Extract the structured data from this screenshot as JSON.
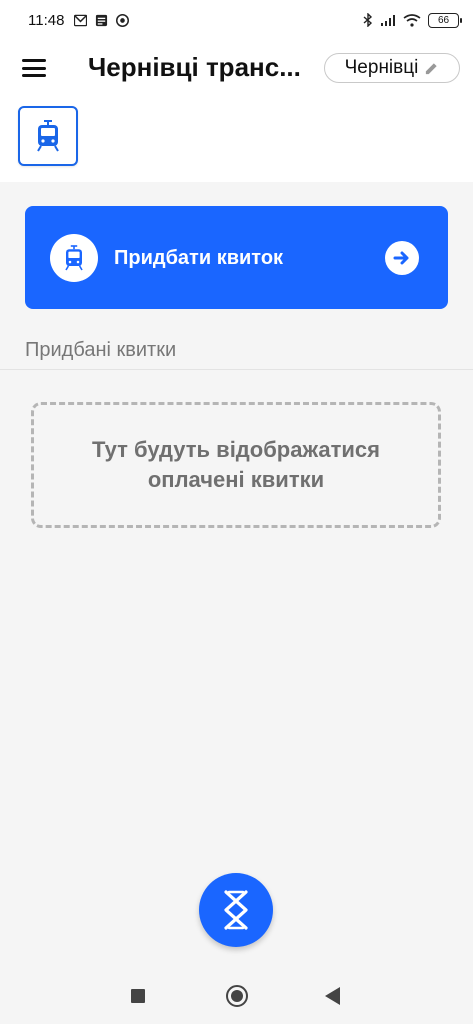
{
  "status_bar": {
    "time": "11:48",
    "battery": "66",
    "icons": [
      "gmail-icon",
      "news-icon",
      "chrome-icon",
      "bluetooth-icon",
      "signal-icon",
      "wifi-icon",
      "battery-icon"
    ]
  },
  "app_bar": {
    "title": "Чернівці транс...",
    "city": "Чернівці",
    "icons": [
      "menu-icon",
      "edit-pencil-icon"
    ]
  },
  "transport": {
    "selected_icon": "tram-icon",
    "accent_color": "#1a66e8"
  },
  "buy_card": {
    "label": "Придбати квиток",
    "background_color": "#1a66ff",
    "icons": [
      "tram-icon",
      "arrow-right-icon"
    ]
  },
  "purchased": {
    "section_title": "Придбані квитки",
    "empty_text": "Тут будуть відображатися оплачені квитки"
  },
  "fab": {
    "icon": "nfc-validator-icon",
    "color": "#1a66ff"
  },
  "nav_bar": {
    "icons": [
      "recents-square-icon",
      "home-circle-icon",
      "back-triangle-icon"
    ]
  }
}
